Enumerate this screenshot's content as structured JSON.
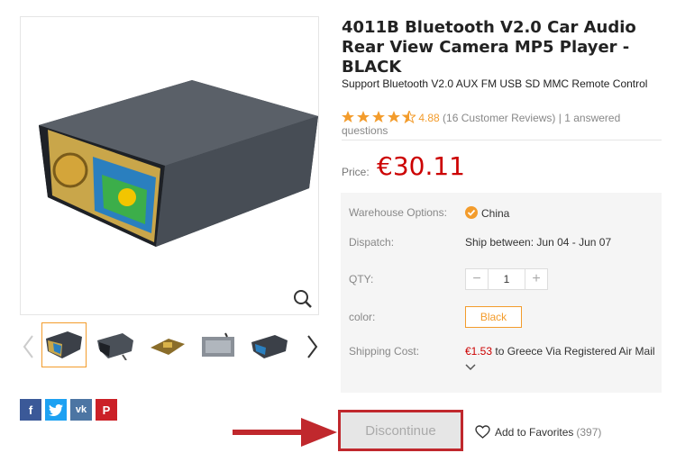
{
  "product": {
    "title": "4011B Bluetooth V2.0 Car Audio Rear View Camera MP5 Player - BLACK",
    "subtitle": "Support Bluetooth V2.0 AUX FM USB SD MMC Remote Control",
    "rating": {
      "stars": 4.5,
      "value": "4.88",
      "reviews": "(16 Customer Reviews)",
      "separator": "|",
      "questions": "1 answered questions"
    },
    "price_label": "Price:",
    "price": "€30.11"
  },
  "options": {
    "warehouse_label": "Warehouse Options:",
    "warehouse_value": "China",
    "dispatch_label": "Dispatch:",
    "dispatch_value": "Ship between: Jun 04 - Jun 07",
    "qty_label": "QTY:",
    "qty_value": "1",
    "qty_minus": "−",
    "qty_plus": "+",
    "color_label": "color:",
    "color_value": "Black",
    "shipping_label": "Shipping Cost:",
    "shipping_cost": "€1.53",
    "shipping_text": " to Greece Via Registered Air Mail"
  },
  "actions": {
    "discontinue": "Discontinue",
    "favorites": "Add to Favorites",
    "favorites_count": "(397)"
  },
  "social": {
    "facebook": "f",
    "vk": "vk",
    "pinterest": "P"
  },
  "icons": [
    "zoom-icon",
    "check-icon",
    "chevron-down-icon",
    "heart-icon",
    "facebook-icon",
    "twitter-icon",
    "vk-icon",
    "pinterest-icon"
  ],
  "colors": {
    "accent": "#f39c2c",
    "price": "#cc0000",
    "annotation": "#c0282d"
  }
}
